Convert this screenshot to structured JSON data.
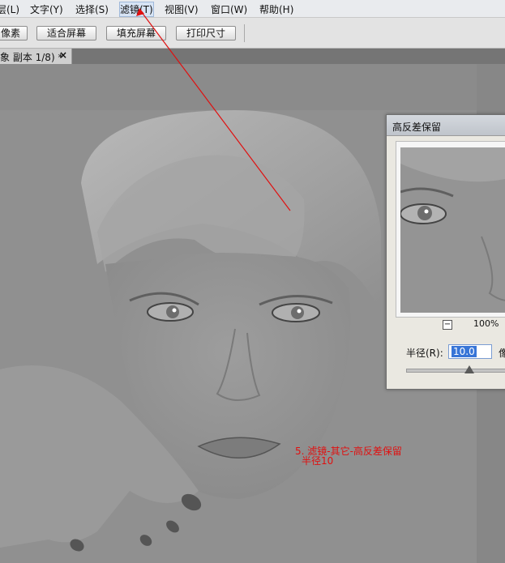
{
  "menu": {
    "items": [
      {
        "label": "层(L)"
      },
      {
        "label": "文字(Y)"
      },
      {
        "label": "选择(S)"
      },
      {
        "label": "滤镜(T)"
      },
      {
        "label": "视图(V)"
      },
      {
        "label": "窗口(W)"
      },
      {
        "label": "帮助(H)"
      }
    ]
  },
  "options": {
    "actual_pixels": "像素",
    "fit_screen": "适合屏幕",
    "fill_screen": "填充屏幕",
    "print_size": "打印尺寸"
  },
  "tab": {
    "title": "象 副本 1/8) *",
    "close": "×"
  },
  "annotation": {
    "line1": "5. 滤镜-其它-高反差保留",
    "line2": "半径10",
    "color": "#e01010"
  },
  "dialog": {
    "title": "高反差保留",
    "zoom": "100%",
    "zoom_out_glyph": "−",
    "radius_label": "半径(R):",
    "radius_value": "10.0",
    "unit": "像"
  }
}
